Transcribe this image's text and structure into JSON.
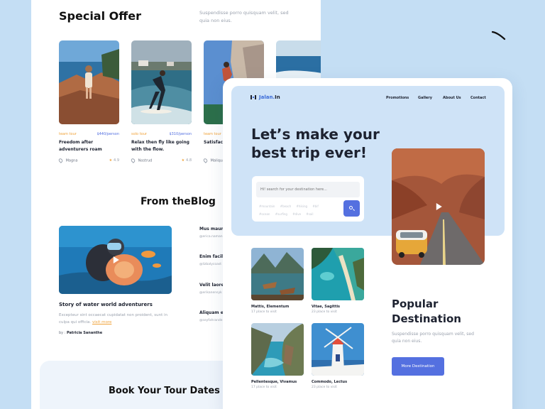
{
  "back": {
    "special_offer": {
      "title": "Special Offer",
      "subtitle": "Suspendisse porro quisquam velit, sed quia non eius.",
      "cards": [
        {
          "tag": "team tour",
          "price": "$440/person",
          "title": "Freedom after adventurers roam",
          "location": "Magna",
          "rating": "4.9"
        },
        {
          "tag": "solo tour",
          "price": "$310/person",
          "title": "Relax then fly like going with the flow.",
          "location": "Nostrud",
          "rating": "4.8"
        },
        {
          "tag": "team tour",
          "price": "",
          "title": "Satisfactio clouds.",
          "location": "Maliqua",
          "rating": ""
        },
        {
          "tag": "",
          "price": "",
          "title": "",
          "location": "",
          "rating": ""
        }
      ]
    },
    "blog": {
      "title": "From theBlog",
      "post_title": "Story of water world adventurers",
      "post_desc": "Excepteur sint occaecat cupidatat non proident, sunt in culpa qui officia.",
      "visit_label": "visit more",
      "by_label": "by :",
      "author": "Patricia Sananthe",
      "side_posts": [
        {
          "title": "Mus mauris leo.",
          "author": "@erica.namani"
        },
        {
          "title": "Enim facilis a cras semp",
          "author": "@lizbalycoast"
        },
        {
          "title": "Velit laoree tincidunt.",
          "author": "@erikanensyk"
        },
        {
          "title": "Aliquam ele posuere eli",
          "author": "@seyfahrande"
        }
      ]
    },
    "book_title": "Book Your Tour Dates N"
  },
  "front": {
    "logo": "Jalan.",
    "logo_suffix": " In",
    "nav": [
      "Promotions",
      "Gallery",
      "About Us",
      "Contact"
    ],
    "hero_title": "Let’s make your best trip ever!",
    "search_placeholder": "Hi! search for your destination here...",
    "chips": [
      "#mountain",
      "#beach",
      "#hiking",
      "#bif",
      "#ocean",
      "#surfing",
      "#dive",
      "#sail"
    ],
    "destinations": [
      {
        "name": "Mattis, Elementum",
        "count": "17 place to visit"
      },
      {
        "name": "Vitae, Sagittis",
        "count": "23 place to visit"
      },
      {
        "name": "Pellentesque, Vivamus",
        "count": "17 place to visit"
      },
      {
        "name": "Commodo, Lectus",
        "count": "23 place to visit"
      }
    ],
    "popular_title": "Popular Destination",
    "popular_desc": "Suspendisse porro quisquam velit, sed quia non eius.",
    "more_button": "More Destination"
  },
  "colors": {
    "background": "#c4def4",
    "accent_blue": "#5470e0",
    "accent_orange": "#f0a33a",
    "hero_bg": "#cfe3f7",
    "text_dark": "#1d2230"
  }
}
